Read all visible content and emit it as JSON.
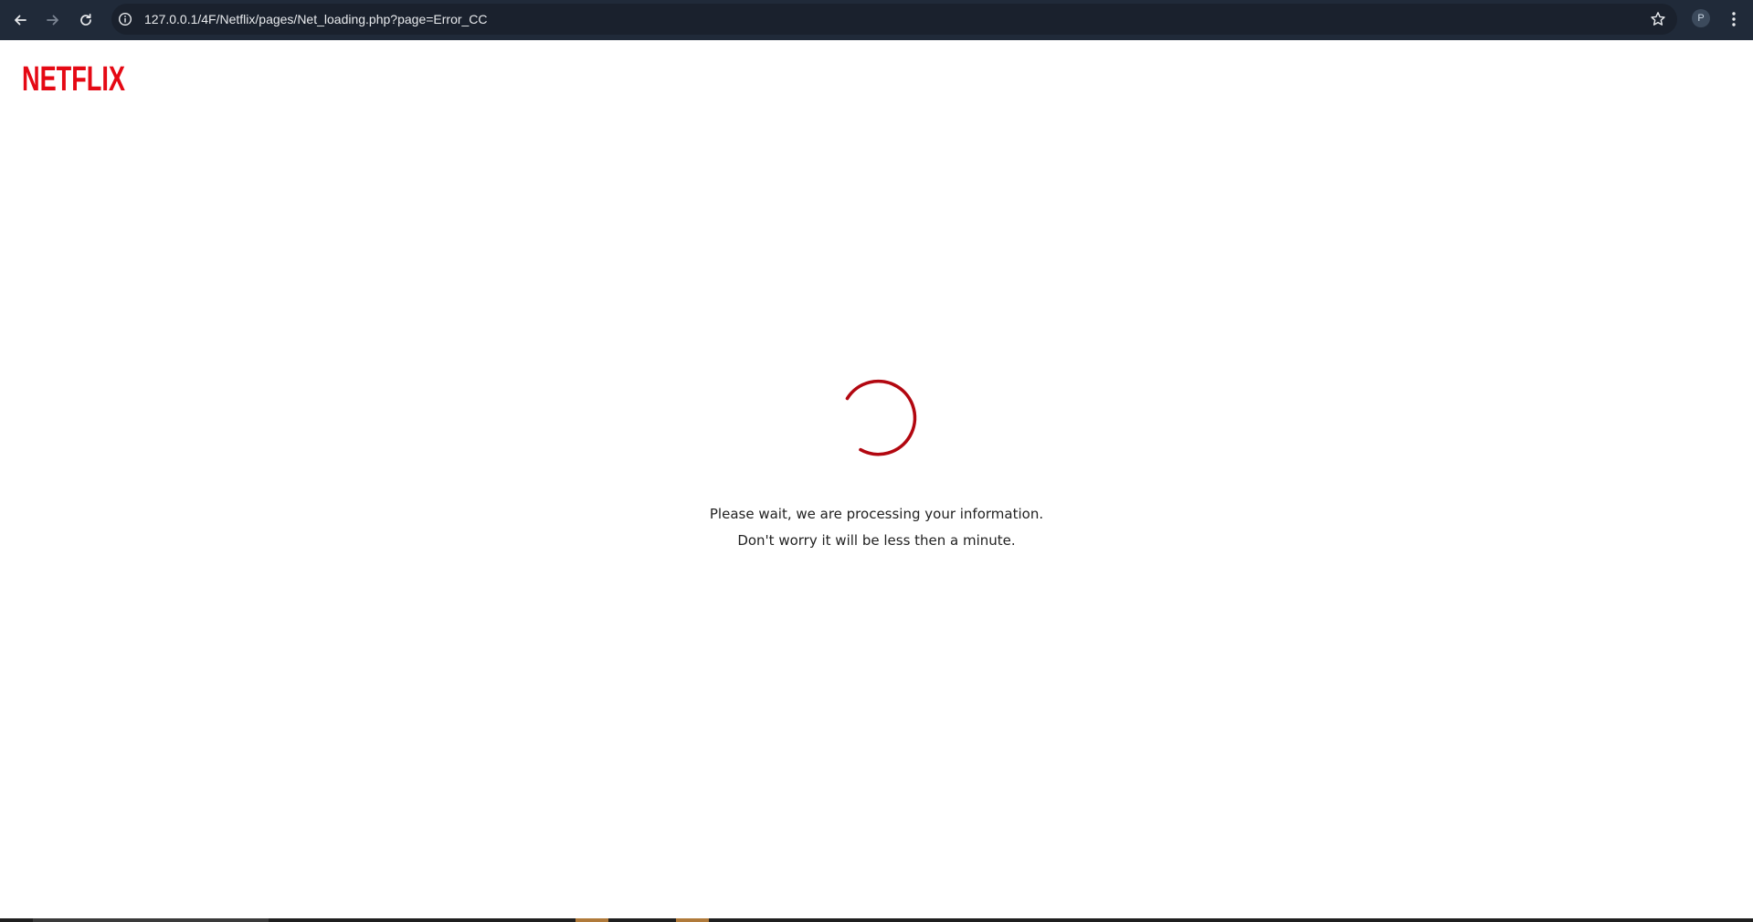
{
  "browser": {
    "url": "127.0.0.1/4F/Netflix/pages/Net_loading.php?page=Error_CC",
    "profile_initial": "P"
  },
  "brand": {
    "logo_text": "NETFLIX",
    "color": "#e50914"
  },
  "loading": {
    "line1": "Please wait, we are processing your information.",
    "line2": "Don't worry it will be less then a minute.",
    "spinner_color": "#b20710"
  }
}
